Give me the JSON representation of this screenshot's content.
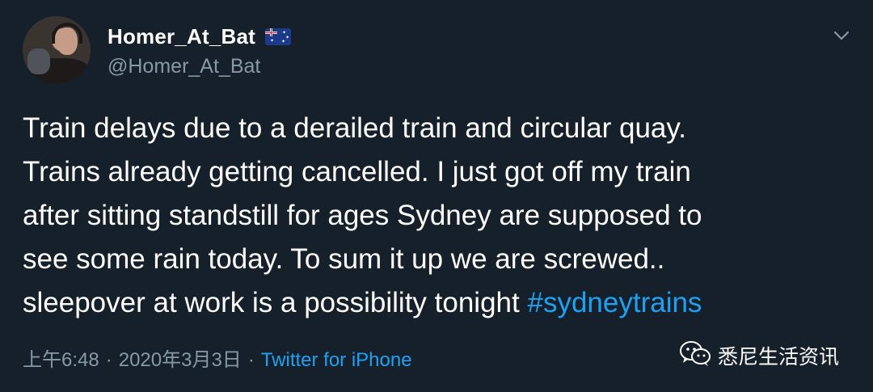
{
  "user": {
    "display_name": "Homer_At_Bat",
    "flag": "australia-flag-icon",
    "handle": "@Homer_At_Bat"
  },
  "tweet": {
    "lines": [
      "Train delays due to a derailed train and circular quay.",
      "Trains already getting cancelled.  I just got off my train",
      "after sitting standstill for ages Sydney are supposed to",
      "see some rain today. To sum it up we are screwed..",
      "sleepover at work is a possibility tonight"
    ],
    "hashtag": "#sydneytrains"
  },
  "meta": {
    "time": "上午6:48",
    "separator": "·",
    "date": "2020年3月3日",
    "source": "Twitter for iPhone"
  },
  "watermark": {
    "text": "悉尼生活资讯"
  },
  "colors": {
    "background": "#15202b",
    "text": "#ffffff",
    "secondary": "#8899a6",
    "accent": "#1da1f2"
  }
}
